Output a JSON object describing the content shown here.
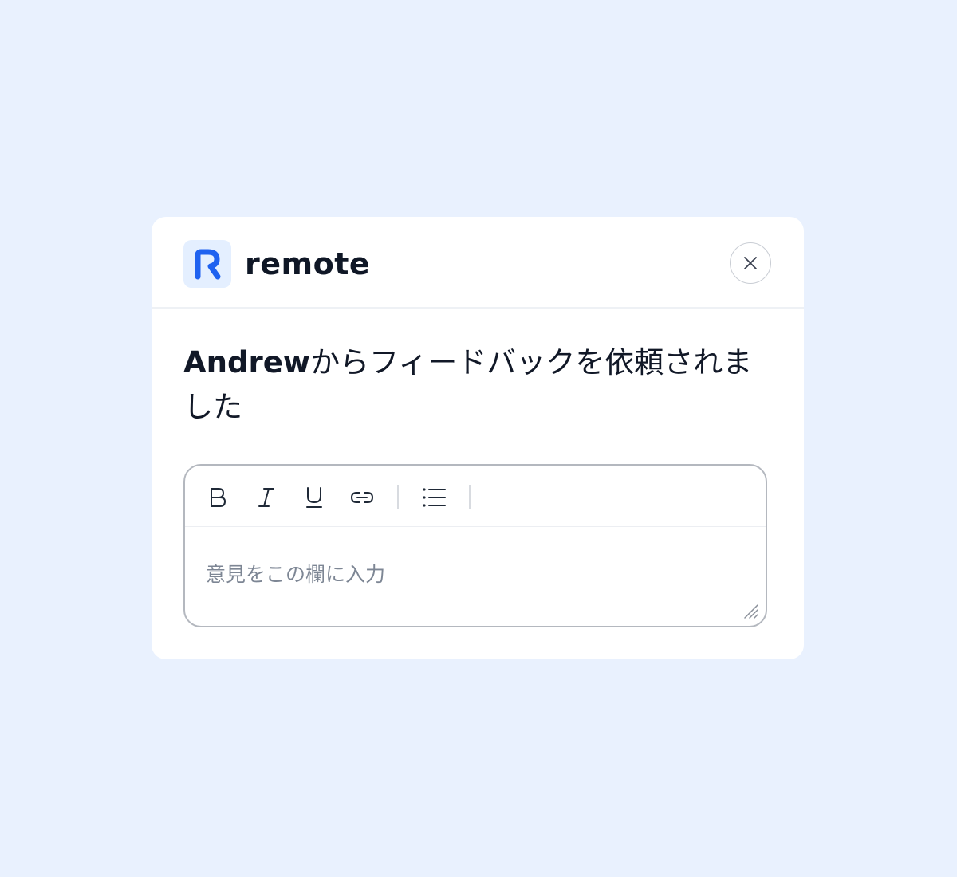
{
  "brand": {
    "name": "remote",
    "logo_letter_icon": "remote-r-logo-icon",
    "accent_color": "#1f62f0"
  },
  "close": {
    "icon": "close-icon"
  },
  "title": {
    "name": "Andrew",
    "rest": "からフィードバックを依頼されました"
  },
  "editor": {
    "toolbar": [
      {
        "name": "bold",
        "icon": "bold-icon"
      },
      {
        "name": "italic",
        "icon": "italic-icon"
      },
      {
        "name": "underline",
        "icon": "underline-icon"
      },
      {
        "name": "link",
        "icon": "link-icon"
      },
      {
        "name": "bullet-list",
        "icon": "bullet-list-icon"
      }
    ],
    "placeholder": "意見をこの欄に入力",
    "value": ""
  }
}
